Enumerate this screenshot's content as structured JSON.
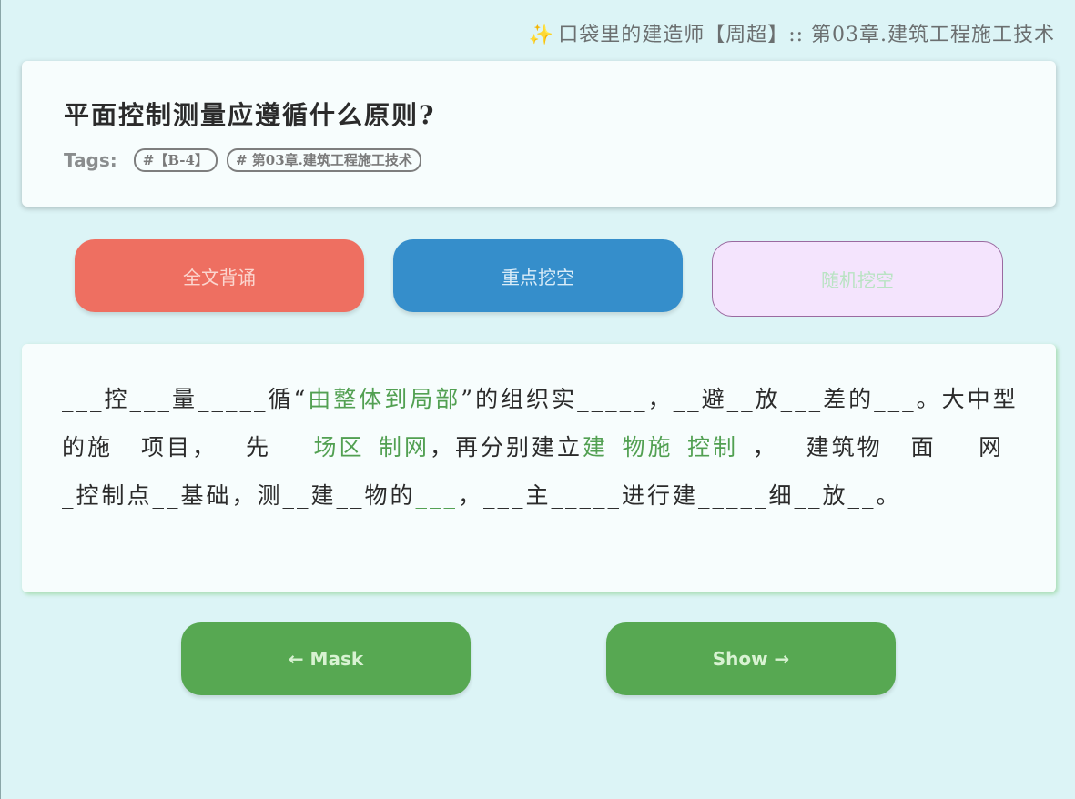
{
  "header": {
    "spark_icon": "✨",
    "deck_title": "口袋里的建造师【周超】:: 第03章.建筑工程施工技术"
  },
  "question": {
    "title": "平面控制测量应遵循什么原则?",
    "tags_label": "Tags:",
    "tags": [
      "#【B-4】",
      "# 第03章.建筑工程施工技术"
    ]
  },
  "modes": {
    "full": "全文背诵",
    "key": "重点挖空",
    "random": "随机挖空"
  },
  "answer": {
    "segments": [
      {
        "t": "___控___量_____循“",
        "hl": false
      },
      {
        "t": "由整体到局部",
        "hl": true
      },
      {
        "t": "”的组织实_____，__避__放___差的___。大中型的施__项目，__先___",
        "hl": false
      },
      {
        "t": "场区_制网",
        "hl": true
      },
      {
        "t": "，再分别建立",
        "hl": false
      },
      {
        "t": "建_物施_控制_",
        "hl": true
      },
      {
        "t": "，__建筑物__面___网__控制点__基础，测__建__物的",
        "hl": false
      },
      {
        "t": "___",
        "hl": true
      },
      {
        "t": "，___主_____进行建_____细__放__。",
        "hl": false
      }
    ]
  },
  "nav": {
    "mask": "← Mask",
    "show": "Show →"
  },
  "colors": {
    "background": "#dcf4f6",
    "card": "#f7fdfd",
    "full_button": "#ee6f61",
    "key_button": "#358ecb",
    "random_button": "#f4e4fd",
    "nav_button": "#57a852",
    "highlight_text": "#52a052"
  }
}
